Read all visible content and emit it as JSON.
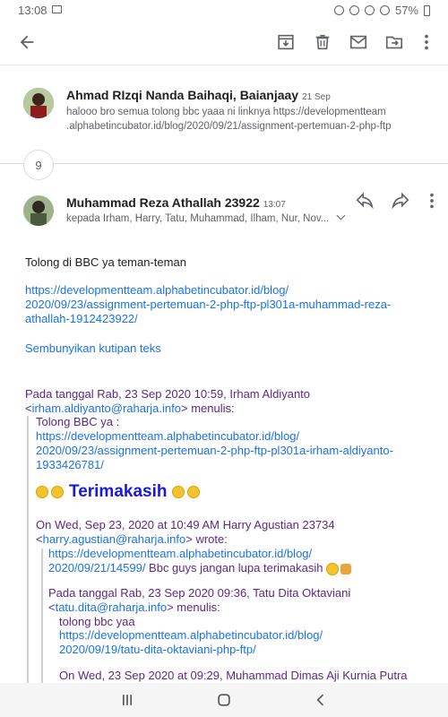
{
  "status_bar": {
    "time": "13:08",
    "battery": "57%"
  },
  "toolbar": {
    "back": "back",
    "archive": "archive",
    "delete": "delete",
    "mark_unread": "mark unread",
    "move": "move to",
    "more": "more options"
  },
  "email1": {
    "sender": "Ahmad RIzqi Nanda Baihaqi, Baianjaay",
    "date": "21 Sep",
    "snippet_line1": "halooo bro semua tolong bbc yaaa ni linknya https://developmentteam",
    "snippet_line2": ".alphabetincubator.id/blog/2020/09/21/assignment-pertemuan-2-php-ftp"
  },
  "collapsed_count": "9",
  "email2": {
    "sender": "Muhammad Reza Athallah 23922",
    "time": "13:07",
    "recipients": "kepada Irham, Harry, Tatu, Muhammad, Ilham, Nur, Nov...",
    "body_intro": "Tolong di  BBC ya teman-teman",
    "link_line1": "https://developmentteam.alphabetincubator.id/blog/",
    "link_line2": "2020/09/23/assignment-pertemuan-2-php-ftp-pl301a-muhammad-reza-",
    "link_line3": "athallah-1912423922/",
    "hide_quoted": "Sembunyikan kutipan teks",
    "q1_header_line1": "Pada tanggal Rab, 23 Sep 2020 10:59, Irham Aldiyanto",
    "q1_header_email": "irham.aldiyanto@raharja.info",
    "q1_header_suffix": "> menulis:",
    "q1_text": "Tolong BBC ya :",
    "q1_link_line1": "https://developmentteam.alphabetincubator.id/blog/",
    "q1_link_line2": "2020/09/23/assignment-pertemuan-2-php-ftp-pl301a-irham-aldiyanto-",
    "q1_link_line3": "1933426781/",
    "thanks": "Terimakasih",
    "q2_header_line1": "On Wed, Sep 23, 2020 at 10:49 AM Harry Agustian 23734",
    "q2_header_email": "harry.agustian@raharja.info",
    "q2_header_suffix": "> wrote:",
    "q2_link_line1": "https://developmentteam.alphabetincubator.id/blog/",
    "q2_link_line2": "2020/09/21/14599/",
    "q2_text": " Bbc guys jangan lupa terimakasih",
    "q3_header_line1": "Pada tanggal Rab, 23 Sep 2020 09:36, Tatu Dita Oktaviani",
    "q3_header_email": "tatu.dita@raharja.info",
    "q3_header_suffix": "> menulis:",
    "q3_text": "tolong bbc yaa",
    "q3_link_line1": "https://developmentteam.alphabetincubator.id/blog/",
    "q3_link_line2": "2020/09/19/tatu-dita-oktaviani-php-ftp/",
    "q4_header_line1": "On Wed, 23 Sep 2020 at 09:29, Muhammad Dimas Aji Kurnia Putra"
  },
  "colors": {
    "link": "#1a73e8",
    "quote_purple": "#5a2a82",
    "thanks_blue": "#1a1ad8"
  }
}
